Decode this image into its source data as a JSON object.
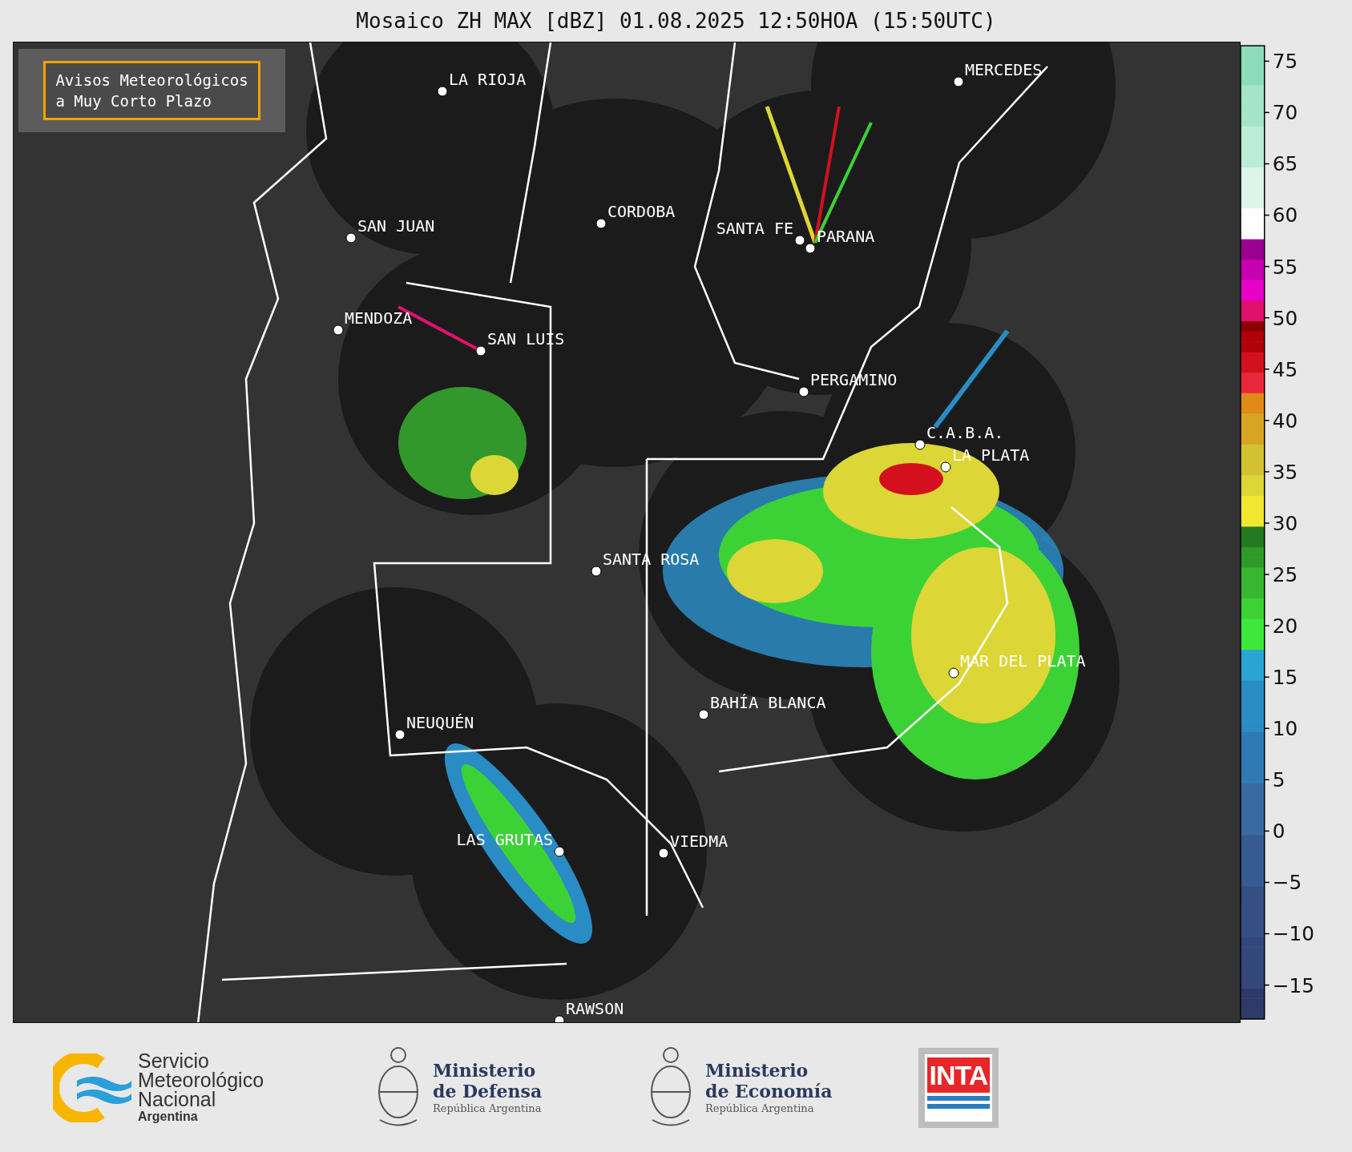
{
  "title": "Mosaico ZH MAX [dBZ] 01.08.2025 12:50HOA (15:50UTC)",
  "map": {
    "alert_box": [
      "Avisos Meteorológicos",
      "a Muy Corto Plazo"
    ],
    "cities": [
      "LA RIOJA",
      "MERCEDES",
      "CORDOBA",
      "SAN JUAN",
      "SANTA FE",
      "PARANA",
      "MENDOZA",
      "SAN LUIS",
      "PERGAMINO",
      "C.A.B.A.",
      "LA PLATA",
      "SANTA ROSA",
      "MAR DEL PLATA",
      "BAHÍA BLANCA",
      "NEUQUÉN",
      "LAS GRUTAS",
      "VIEDMA",
      "RAWSON"
    ]
  },
  "colorbar": {
    "ticks": [
      "75",
      "70",
      "65",
      "60",
      "55",
      "50",
      "45",
      "40",
      "35",
      "30",
      "25",
      "20",
      "15",
      "10",
      "5",
      "0",
      "−5",
      "−10",
      "−15"
    ]
  },
  "footer": {
    "logos": [
      {
        "kind": "smn",
        "lines": [
          "Servicio",
          "Meteorológico",
          "Nacional",
          "Argentina"
        ]
      },
      {
        "kind": "ministry",
        "lines": [
          "Ministerio",
          "de Defensa",
          "República Argentina"
        ]
      },
      {
        "kind": "ministry",
        "lines": [
          "Ministerio",
          "de Economía",
          "República Argentina"
        ]
      },
      {
        "kind": "inta",
        "lines": [
          "INTA"
        ]
      }
    ]
  }
}
